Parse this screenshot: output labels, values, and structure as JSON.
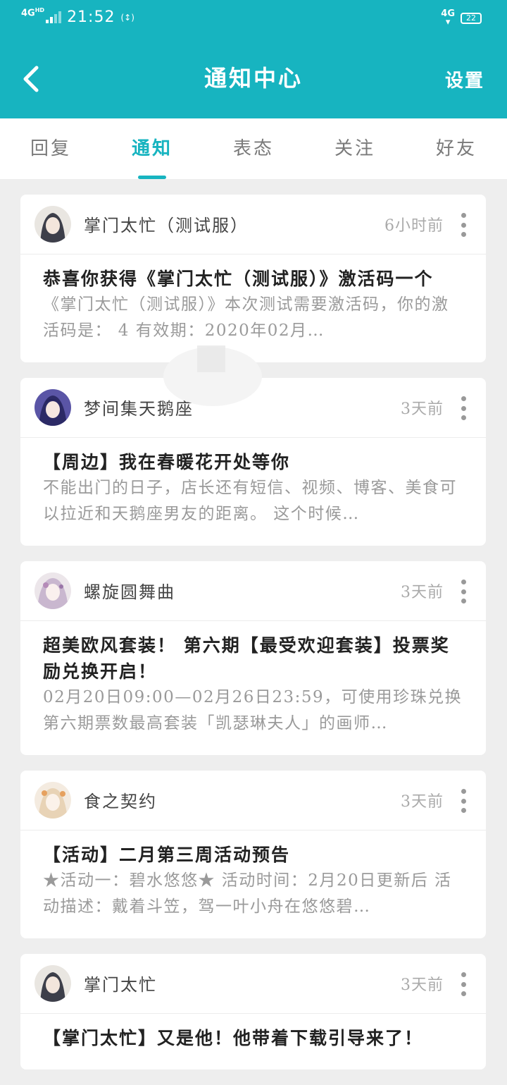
{
  "status_bar": {
    "network_left": "4G",
    "network_left_sub": "HD",
    "time": "21:52",
    "network_right": "4G",
    "battery": "22"
  },
  "header": {
    "title": "通知中心",
    "settings_label": "设置"
  },
  "tabs": [
    {
      "label": "回复",
      "active": false
    },
    {
      "label": "通知",
      "active": true
    },
    {
      "label": "表态",
      "active": false
    },
    {
      "label": "关注",
      "active": false
    },
    {
      "label": "好友",
      "active": false
    }
  ],
  "notifications": [
    {
      "author": "掌门太忙（测试服）",
      "time": "6小时前",
      "title": "恭喜你获得《掌门太忙（测试服）》激活码一个",
      "excerpt": "《掌门太忙（测试服）》本次测试需要激活码，你的激活码是：        4 有效期：2020年02月…"
    },
    {
      "author": "梦间集天鹅座",
      "time": "3天前",
      "title": "【周边】我在春暖花开处等你",
      "excerpt": "不能出门的日子，店长还有短信、视频、博客、美食可以拉近和天鹅座男友的距离。 这个时候…"
    },
    {
      "author": "螺旋圆舞曲",
      "time": "3天前",
      "title": "超美欧风套装！ 第六期【最受欢迎套装】投票奖励兑换开启！",
      "excerpt": "02月20日09:00—02月26日23:59，可使用珍珠兑换第六期票数最高套装「凯瑟琳夫人」的画师…"
    },
    {
      "author": "食之契约",
      "time": "3天前",
      "title": "【活动】二月第三周活动预告",
      "excerpt": "★活动一：碧水悠悠★ 活动时间：2月20日更新后 活动描述：戴着斗笠，驾一叶小舟在悠悠碧…"
    },
    {
      "author": "掌门太忙",
      "time": "3天前",
      "title": "【掌门太忙】又是他！他带着下载引导来了！",
      "excerpt": ""
    }
  ],
  "colors": {
    "accent": "#17b4c0",
    "background": "#eeeeee",
    "muted_text": "#9a9a9a"
  },
  "icons": [
    "back-arrow-icon",
    "more-vertical-icon",
    "avatar"
  ]
}
